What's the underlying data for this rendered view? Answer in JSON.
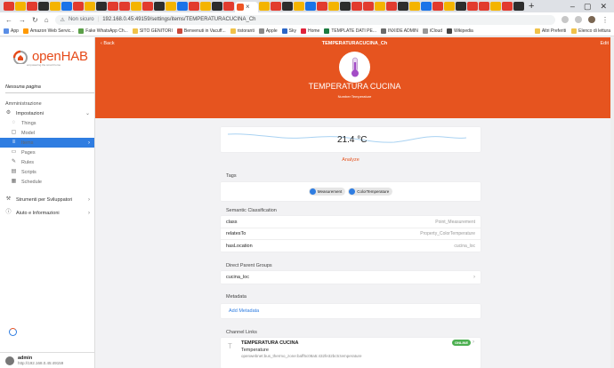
{
  "browser": {
    "url_security": "Non sicuro",
    "url": "192.168.0.45:49159/settings/items/TEMPERATURACUCINA_Ch",
    "bookmarks": [
      {
        "label": "App",
        "color": "#5a8ee6"
      },
      {
        "label": "Amazon Web Servic...",
        "color": "#ff9900"
      },
      {
        "label": "Fake WhatsApp Ch...",
        "color": "#5b9f48"
      },
      {
        "label": "SITO GENITORI",
        "color": "#f0c24a"
      },
      {
        "label": "Benvenuti in Vacuff...",
        "color": "#c94a3b"
      },
      {
        "label": "ristoranti",
        "color": "#f0c24a"
      },
      {
        "label": "Apple",
        "color": "#888888"
      },
      {
        "label": "Sky",
        "color": "#2a66c7"
      },
      {
        "label": "Home",
        "color": "#e0233b"
      },
      {
        "label": "TEMPLATE DATI PE...",
        "color": "#1d7b40"
      },
      {
        "label": "INXIDE ADMIN",
        "color": "#6b6b6b"
      },
      {
        "label": "iCloud",
        "color": "#999999"
      },
      {
        "label": "Wikipedia",
        "color": "#444444"
      }
    ],
    "bookmarks_right": [
      "Altri Preferiti",
      "Elenco di lettura"
    ]
  },
  "sidebar": {
    "logo": "openHAB",
    "logo_tagline": "empowering the smart home",
    "page_selector": "Nessuna pagina",
    "section_title": "Amministrazione",
    "items": [
      {
        "label": "Impostazioni",
        "icon": "gear-icon"
      },
      {
        "label": "Things",
        "icon": "lightbulb-icon"
      },
      {
        "label": "Model",
        "icon": "cube-icon"
      },
      {
        "label": "Items",
        "icon": "list-icon"
      },
      {
        "label": "Pages",
        "icon": "page-icon"
      },
      {
        "label": "Rules",
        "icon": "wand-icon"
      },
      {
        "label": "Scripts",
        "icon": "doc-icon"
      },
      {
        "label": "Schedule",
        "icon": "calendar-icon"
      },
      {
        "label": "Strumenti per Sviluppatori",
        "icon": "tools-icon"
      },
      {
        "label": "Aiuto e Informazioni",
        "icon": "info-icon"
      }
    ],
    "user": {
      "name": "admin",
      "url": "http://192.168.0.45:49159"
    }
  },
  "header": {
    "back_label": "Back",
    "title": "TEMPERATURACUCINA_Ch",
    "edit_label": "Edit",
    "item_label": "TEMPERATURA CUCINA",
    "item_type": "Number:Temperature"
  },
  "state": {
    "value": "21.4 °C",
    "analyze_label": "Analyze"
  },
  "tags": {
    "title": "Tags",
    "items": [
      "Measurement",
      "ColorTemperature"
    ]
  },
  "semantic": {
    "title": "Semantic Classification",
    "rows": [
      {
        "key": "class",
        "value": "Point_Measurement"
      },
      {
        "key": "relatesTo",
        "value": "Property_ColorTemperature"
      },
      {
        "key": "hasLocation",
        "value": "cucina_loc"
      }
    ]
  },
  "groups": {
    "title": "Direct Parent Groups",
    "items": [
      "cucina_loc"
    ]
  },
  "metadata": {
    "title": "Metadata",
    "add_label": "Add Metadata"
  },
  "channels": {
    "title": "Channel Links",
    "items": [
      {
        "name": "TEMPERATURA CUCINA",
        "type": "Temperature",
        "uid": "openwebnet:bus_thermo_zone:baff5c08a5:432fe32bc5:temperature",
        "status": "ONLINE"
      }
    ]
  },
  "colors": {
    "accent": "#e6541f",
    "primary": "#2f7de1",
    "online": "#4caf50"
  }
}
